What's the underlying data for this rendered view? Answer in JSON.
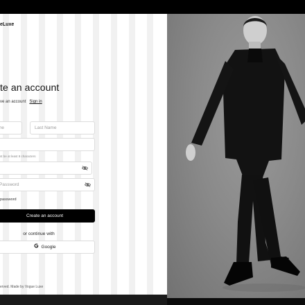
{
  "brand": {
    "name": "eLuxe"
  },
  "form": {
    "title": "te an account",
    "subtitle": "ve an account",
    "signin_link": "Sign in",
    "first_name_placeholder": "me",
    "last_name_placeholder": "Last Name",
    "email_placeholder": "",
    "password_hint": "st be at least 8 characters",
    "password_placeholder": "l",
    "confirm_placeholder": "Password",
    "remember_label": "password",
    "submit_label": "Create an account",
    "divider_text": "or continue with",
    "google_label": "Google"
  },
  "footer": {
    "text": "erved. Made by Vogue Luxe"
  },
  "icons": [
    "eye-off-icon",
    "google-icon"
  ],
  "colors": {
    "primary": "#000000",
    "border": "#dcdcdc",
    "stripe": "#f1f1f1"
  }
}
